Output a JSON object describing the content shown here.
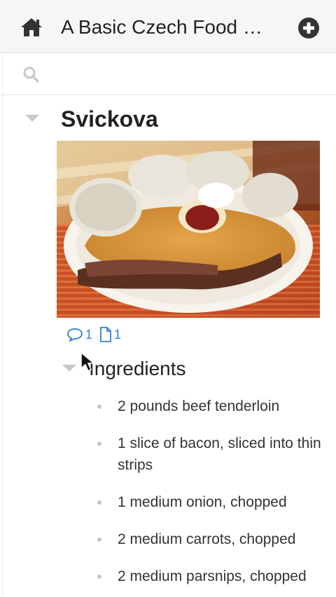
{
  "header": {
    "title": "A Basic Czech Food …",
    "home_icon": "home-icon",
    "add_icon": "add-circle-icon"
  },
  "search": {
    "placeholder": "",
    "value": "",
    "icon": "search-icon"
  },
  "node": {
    "title": "Svickova",
    "image_alt": "Svickova with bread dumplings, cream sauce, cranberries and whipped cream",
    "comments_count": "1",
    "attachments_count": "1"
  },
  "section": {
    "title": "Ingredients",
    "items": [
      "2 pounds beef tenderloin",
      "1 slice of bacon, sliced into thin strips",
      "1 medium onion, chopped",
      "2 medium carrots, chopped",
      "2 medium parsnips, chopped"
    ]
  },
  "colors": {
    "accent": "#2f7fc9",
    "header_bg": "#f6f6f6",
    "caret": "#c9c9c9"
  }
}
